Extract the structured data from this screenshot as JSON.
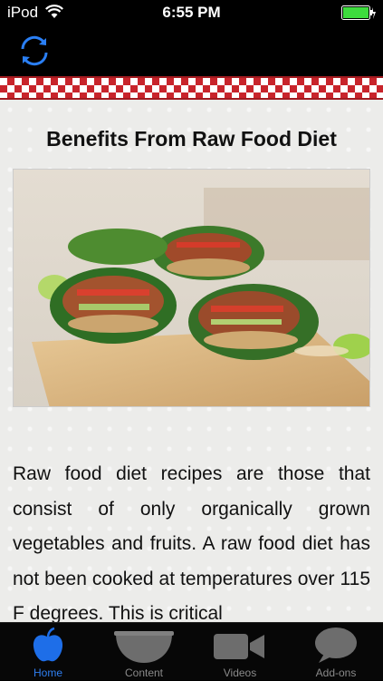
{
  "status_bar": {
    "carrier": "iPod",
    "time": "6:55 PM",
    "icons": [
      "wifi-icon",
      "battery-charging-icon"
    ]
  },
  "nav_bar": {
    "refresh_icon": "refresh-icon"
  },
  "article": {
    "title": "Benefits From Raw Food Diet",
    "image_subject": "raw collard green wraps",
    "body": "Raw food diet recipes are those that consist of only organically grown vegetables and fruits. A raw food diet has not been cooked at temperatures over 115 F degrees. This is critical"
  },
  "tab_bar": {
    "active_color": "#2f7ff0",
    "inactive_color": "#8a8a8a",
    "tabs": [
      {
        "label": "Home",
        "icon": "apple-icon",
        "active": true
      },
      {
        "label": "Content",
        "icon": "bowl-icon",
        "active": false
      },
      {
        "label": "Videos",
        "icon": "video-camera-icon",
        "active": false
      },
      {
        "label": "Add-ons",
        "icon": "speech-bubble-icon",
        "active": false
      }
    ]
  }
}
